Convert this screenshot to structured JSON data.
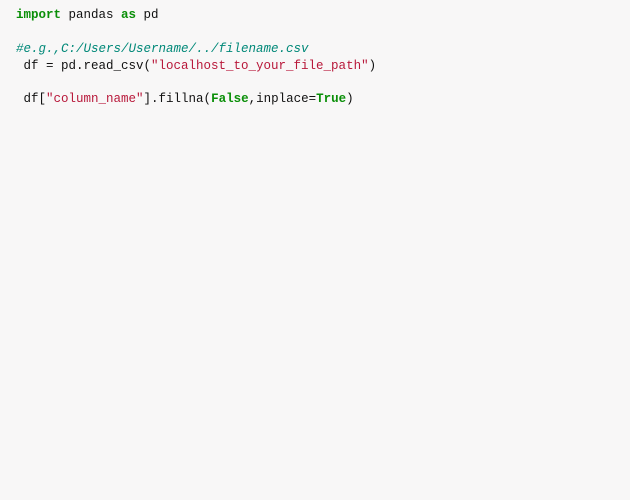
{
  "code": {
    "line1": {
      "import": "import",
      "module": " pandas ",
      "as": "as",
      "alias": " pd"
    },
    "line3_comment": "#e.g.,C:/Users/Username/../filename.csv",
    "line4": {
      "prefix": " df = pd.read_csv(",
      "string": "\"localhost_to_your_file_path\"",
      "suffix": ")"
    },
    "line6": {
      "prefix": " df[",
      "string": "\"column_name\"",
      "mid": "].fillna(",
      "bool": "False",
      "rest": ",inplace=",
      "bool2": "True",
      "end": ")"
    }
  }
}
